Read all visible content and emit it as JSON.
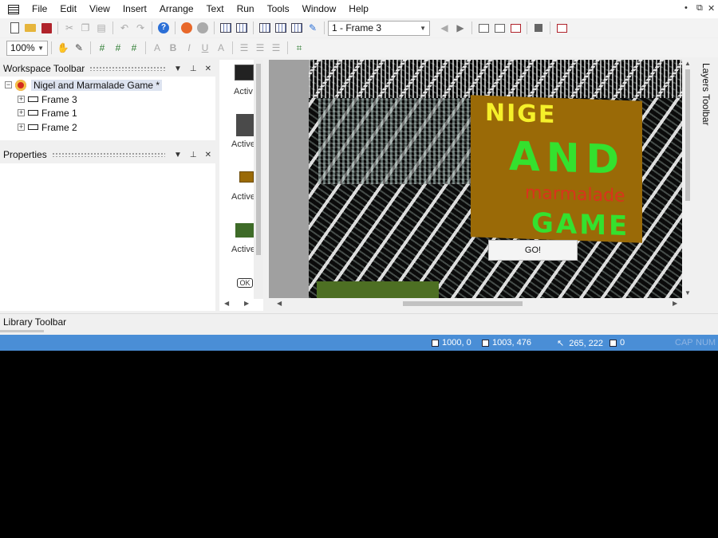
{
  "menubar": {
    "items": [
      "File",
      "Edit",
      "View",
      "Insert",
      "Arrange",
      "Text",
      "Run",
      "Tools",
      "Window",
      "Help"
    ],
    "window_controls": [
      "•",
      "⧉",
      "✕"
    ]
  },
  "toolbar": {
    "frame_select": "1 - Frame 3",
    "zoom": "100%"
  },
  "workspace": {
    "title": "Workspace Toolbar",
    "root": "Nigel and Marmalade Game *",
    "frames": [
      "Frame 3",
      "Frame 1",
      "Frame 2"
    ]
  },
  "properties": {
    "title": "Properties"
  },
  "objects": {
    "labels": [
      "Activ",
      "Active",
      "Active",
      "Active",
      "OK"
    ]
  },
  "stage": {
    "sign_line1": "NIGE",
    "sign_line2": "AND",
    "sign_line3": "marmalade",
    "sign_line4": "GAME",
    "go_button": "GO!"
  },
  "layers": {
    "title": "Layers Toolbar"
  },
  "library": {
    "title": "Library Toolbar"
  },
  "statusbar": {
    "pos1": "1000, 0",
    "pos2": "1003, 476",
    "cursor": "265, 222",
    "count": "0",
    "cap": "CAP",
    "num": "NUM"
  },
  "colors": {
    "statusbar": "#4a8ed6",
    "sign": "#9a6a07",
    "sign_yellow": "#f5f02a",
    "sign_green": "#34e12e",
    "sign_red": "#d8341c",
    "ground": "#4d6f23"
  }
}
